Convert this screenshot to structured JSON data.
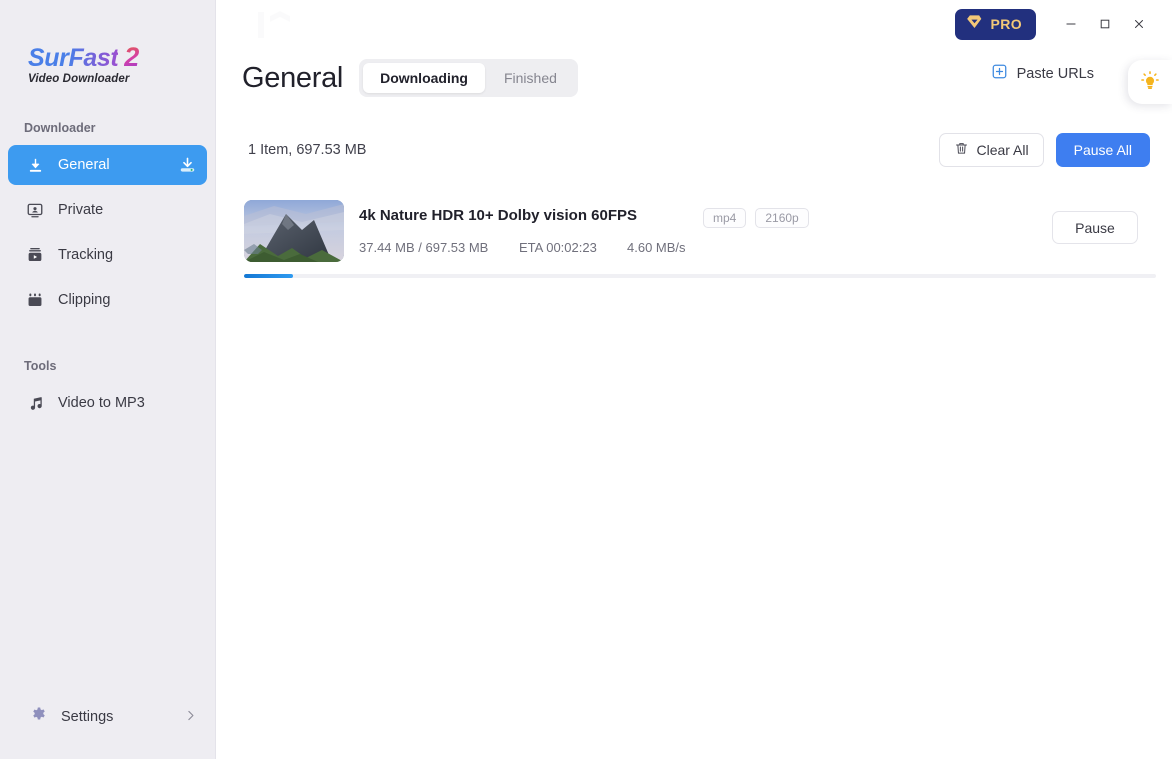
{
  "brand": {
    "name_part1": "Sur",
    "name_part2": "Fast",
    "name_number": "2",
    "tagline": "Video Downloader"
  },
  "sidebar": {
    "downloader_label": "Downloader",
    "tools_label": "Tools",
    "items": [
      {
        "label": "General",
        "icon": "download-icon",
        "active": true,
        "badge": "download-badge-icon"
      },
      {
        "label": "Private",
        "icon": "person-card-icon",
        "active": false
      },
      {
        "label": "Tracking",
        "icon": "video-monitor-icon",
        "active": false
      },
      {
        "label": "Clipping",
        "icon": "clipboard-icon",
        "active": false
      }
    ],
    "tools": [
      {
        "label": "Video to MP3",
        "icon": "music-note-icon"
      }
    ],
    "settings": {
      "label": "Settings",
      "icon": "gear-icon",
      "chevron": "chevron-right-icon"
    }
  },
  "titlebar": {
    "pro_label": "PRO",
    "pro_icon": "diamond-shield-icon",
    "minimize_icon": "minimize-icon",
    "maximize_icon": "maximize-icon",
    "close_icon": "close-icon"
  },
  "header": {
    "title": "General",
    "tabs": [
      {
        "label": "Downloading",
        "active": true
      },
      {
        "label": "Finished",
        "active": false
      }
    ],
    "paste_urls": {
      "label": "Paste URLs",
      "icon": "plus-square-icon"
    },
    "tips_icon": "lightbulb-icon"
  },
  "toolbar": {
    "item_count": "1 Item, 697.53 MB",
    "clear_all_label": "Clear All",
    "clear_all_icon": "trash-icon",
    "pause_all_label": "Pause All"
  },
  "download_item": {
    "title": "4k Nature HDR  10+ Dolby vision 60FPS",
    "thumbnail_icon": "mountain-landscape-thumbnail",
    "badges": [
      "mp4",
      "2160p"
    ],
    "downloaded": "37.44 MB / 697.53 MB",
    "eta": "ETA 00:02:23",
    "speed": "4.60 MB/s",
    "pause_label": "Pause",
    "progress_percent": 5.4
  },
  "colors": {
    "accent_blue": "#3e7ef0",
    "sidebar_active": "#3d9bf0",
    "pro_navy": "#22307e",
    "pro_gold": "#f3c878",
    "sidebar_bg": "#eeedf2",
    "progress_start": "#1478d4",
    "progress_end": "#2e9af0",
    "bulb_yellow": "#f5b41d"
  }
}
